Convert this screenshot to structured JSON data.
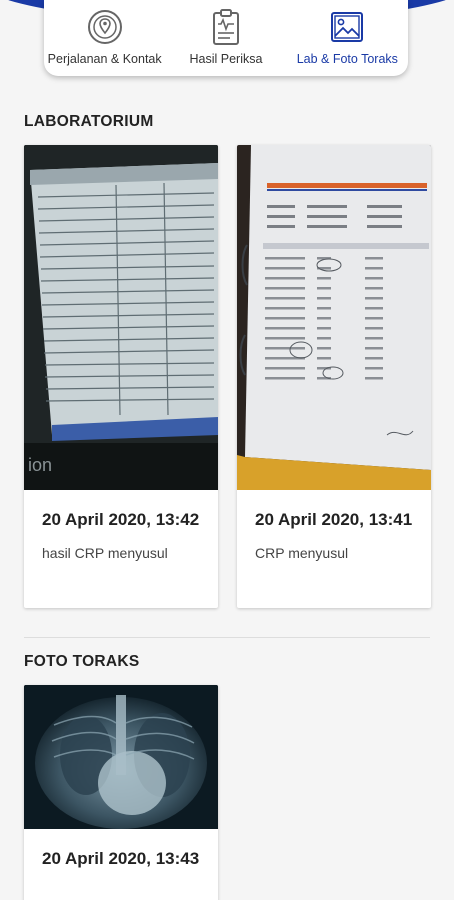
{
  "tabs": [
    {
      "label": "Perjalanan & Kontak",
      "icon": "location-icon"
    },
    {
      "label": "Hasil Periksa",
      "icon": "clipboard-icon"
    },
    {
      "label": "Lab & Foto Toraks",
      "icon": "image-icon"
    }
  ],
  "active_tab": 2,
  "laboratorium": {
    "title": "LABORATORIUM",
    "items": [
      {
        "date": "20 April 2020, 13:42",
        "note": "hasil CRP menyusul"
      },
      {
        "date": "20 April 2020, 13:41",
        "note": "CRP menyusul"
      }
    ]
  },
  "foto_toraks": {
    "title": "FOTO TORAKS",
    "items": [
      {
        "date": "20 April 2020, 13:43"
      }
    ]
  },
  "colors": {
    "primary": "#1a3aa6",
    "background": "#f5f5f5"
  }
}
